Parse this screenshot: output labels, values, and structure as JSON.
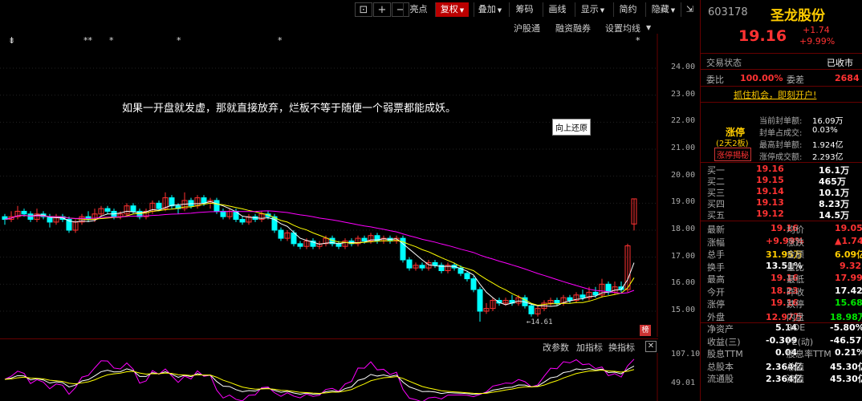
{
  "toolbar": {
    "icons": [
      "lock-icon",
      "plus-icon",
      "minus-icon"
    ],
    "buttons": [
      "亮点",
      "复权",
      "叠加",
      "筹码",
      "画线",
      "显示",
      "简约",
      "隐藏"
    ],
    "dropdown_flags": [
      false,
      true,
      true,
      false,
      false,
      true,
      false,
      true
    ],
    "active_index": 1
  },
  "subbar": {
    "links": [
      "沪股通",
      "融资融券",
      "设置均线"
    ]
  },
  "star_marks": [
    "⇟",
    "**",
    "*",
    "*",
    "*",
    "*"
  ],
  "chart": {
    "y_ticks": [
      "24.00",
      "23.00",
      "22.00",
      "21.00",
      "20.00",
      "19.00",
      "18.00",
      "17.00",
      "16.00",
      "15.00"
    ],
    "annotation": "如果一开盘就发虚，那就直接放弃，烂板不等于随便一个弱票都能成妖。",
    "tooltip": "向上还原",
    "low_label": "14.61",
    "bang_label": "榜"
  },
  "chart_data": {
    "type": "candlestick",
    "ylim": [
      14.5,
      24.5
    ],
    "y_ticks": [
      24,
      23,
      22,
      21,
      20,
      19,
      18,
      17,
      16,
      15
    ],
    "low_marker": 14.61
  },
  "indicator": {
    "links": [
      "改参数",
      "加指标",
      "换指标"
    ],
    "y_ticks": [
      "107.10",
      "49.01"
    ]
  },
  "panel": {
    "code": "603178",
    "name": "圣龙股份",
    "price": "19.16",
    "change": "+1.74",
    "change_pct": "+9.99%",
    "status_label": "交易状态",
    "status_value": "已收市",
    "weibi_label": "委比",
    "weibi_value": "100.00%",
    "weicha_label": "委差",
    "weicha_value": "2684",
    "promo": "抓住机会，即刻开户!",
    "limit_title": "涨停",
    "limit_sub": "(2天2板)",
    "limit_btn": "涨停揭秘",
    "limit_rows": [
      {
        "label": "当前封单额:",
        "value": "16.09万"
      },
      {
        "label": "封单占成交:",
        "value": "0.03%"
      },
      {
        "label": "最高封单额:",
        "value": "1.924亿"
      },
      {
        "label": "涨停成交额:",
        "value": "2.293亿"
      }
    ],
    "bids": [
      {
        "label": "买一",
        "price": "19.16",
        "vol": "16.1万"
      },
      {
        "label": "买二",
        "price": "19.15",
        "vol": "465万"
      },
      {
        "label": "买三",
        "price": "19.14",
        "vol": "10.1万"
      },
      {
        "label": "买四",
        "price": "19.13",
        "vol": "8.23万"
      },
      {
        "label": "买五",
        "price": "19.12",
        "vol": "14.5万"
      }
    ],
    "stats": [
      {
        "l1": "最新",
        "v1": "19.16",
        "c1": "red",
        "l2": "均价",
        "v2": "19.05",
        "c2": "red"
      },
      {
        "l1": "涨幅",
        "v1": "+9.99%",
        "c1": "red",
        "l2": "涨跌",
        "v2": "▲1.74",
        "c2": "red"
      },
      {
        "l1": "总手",
        "v1": "31.95万",
        "c1": "yellow",
        "l2": "金额",
        "v2": "6.09亿",
        "c2": "yellow"
      },
      {
        "l1": "换手",
        "v1": "13.51%",
        "c1": "white",
        "l2": "量比",
        "v2": "9.32",
        "c2": "red"
      },
      {
        "l1": "最高",
        "v1": "19.16",
        "c1": "red",
        "l2": "最低",
        "v2": "17.99",
        "c2": "red"
      },
      {
        "l1": "今开",
        "v1": "18.23",
        "c1": "red",
        "l2": "昨收",
        "v2": "17.42",
        "c2": "white"
      },
      {
        "l1": "涨停",
        "v1": "19.16",
        "c1": "red",
        "l2": "跌停",
        "v2": "15.68",
        "c2": "green"
      },
      {
        "l1": "外盘",
        "v1": "12.97万",
        "c1": "red",
        "l2": "内盘",
        "v2": "18.98万",
        "c2": "green"
      },
      {
        "l1": "净资产",
        "v1": "5.14",
        "c1": "white",
        "l2": "ROE",
        "v2": "-5.80%",
        "c2": "white"
      },
      {
        "l1": "收益(三)",
        "v1": "-0.309",
        "c1": "white",
        "l2": "PE(动)",
        "v2": "-46.57",
        "c2": "white"
      },
      {
        "l1": "股息TTM",
        "v1": "0.04",
        "c1": "white",
        "l2": "股息率TTM",
        "v2": "0.21%",
        "c2": "white"
      },
      {
        "l1": "总股本",
        "v1": "2.364亿",
        "c1": "white",
        "l2": "总值",
        "v2": "45.30亿",
        "c2": "white"
      },
      {
        "l1": "流通股",
        "v1": "2.364亿",
        "c1": "white",
        "l2": "流值",
        "v2": "45.30亿",
        "c2": "white"
      }
    ]
  }
}
